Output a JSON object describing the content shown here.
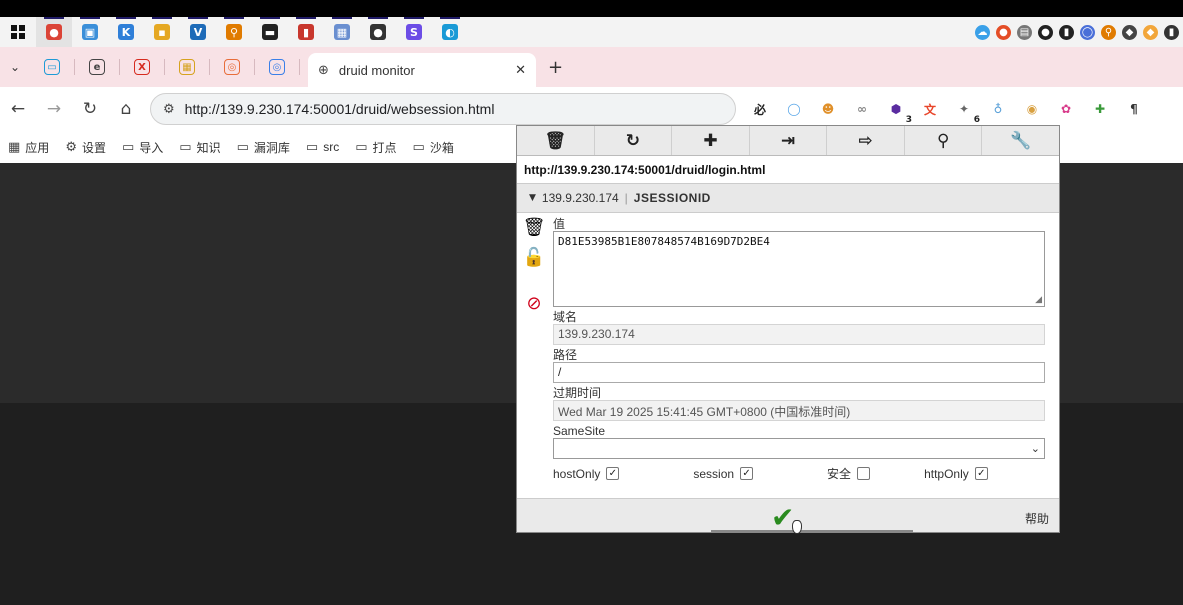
{
  "taskbar": {
    "items": [
      {
        "name": "chrome-icon",
        "glyph": "●",
        "color": "#db4437"
      },
      {
        "name": "app-icon-blue",
        "glyph": "▣",
        "color": "#3b8fd9"
      },
      {
        "name": "app-icon-k",
        "glyph": "K",
        "color": "#2f7fd8"
      },
      {
        "name": "app-icon-yellow",
        "glyph": "▪",
        "color": "#e5a823"
      },
      {
        "name": "app-icon-v",
        "glyph": "V",
        "color": "#1e6bb8"
      },
      {
        "name": "search-app-icon",
        "glyph": "⚲",
        "color": "#e07b00"
      },
      {
        "name": "terminal-icon",
        "glyph": "▬",
        "color": "#222222"
      },
      {
        "name": "app-icon-red",
        "glyph": "▮",
        "color": "#c8372d"
      },
      {
        "name": "app-icon-grid",
        "glyph": "▦",
        "color": "#6a8fd0"
      },
      {
        "name": "app-icon-dark",
        "glyph": "●",
        "color": "#333333"
      },
      {
        "name": "app-icon-s",
        "glyph": "S",
        "color": "#6c4de6"
      },
      {
        "name": "edge-icon",
        "glyph": "◐",
        "color": "#1a9ad6"
      }
    ],
    "tray": [
      {
        "name": "cloud-icon",
        "glyph": "☁",
        "color": "#3aa0e8"
      },
      {
        "name": "tray-app-icon",
        "glyph": "●",
        "color": "#e44d26"
      },
      {
        "name": "chat-icon",
        "glyph": "▤",
        "color": "#777777"
      },
      {
        "name": "tray-dark-icon",
        "glyph": "●",
        "color": "#222222"
      },
      {
        "name": "mic-icon",
        "glyph": "▮",
        "color": "#222222"
      },
      {
        "name": "tray-circle-icon",
        "glyph": "◯",
        "color": "#4a6fd8"
      },
      {
        "name": "tray-key-icon",
        "glyph": "⚲",
        "color": "#e07b00"
      },
      {
        "name": "tray-box-icon",
        "glyph": "◆",
        "color": "#444444"
      },
      {
        "name": "tray-flame-icon",
        "glyph": "◆",
        "color": "#f2a63a"
      },
      {
        "name": "tray-extra-icon",
        "glyph": "▮",
        "color": "#333333"
      }
    ]
  },
  "tabs": {
    "pinned": [
      {
        "name": "pinned-tab-bilibili",
        "glyph": "▭",
        "color": "#1e9ad6"
      },
      {
        "name": "pinned-tab-e",
        "glyph": "e",
        "color": "#444444"
      },
      {
        "name": "pinned-tab-x",
        "glyph": "X",
        "color": "#d62a1e"
      },
      {
        "name": "pinned-tab-yellow",
        "glyph": "▦",
        "color": "#d6a21e"
      },
      {
        "name": "pinned-tab-chrome",
        "glyph": "◎",
        "color": "#e86d3a"
      },
      {
        "name": "pinned-tab-circle",
        "glyph": "◎",
        "color": "#3a7fe8"
      }
    ],
    "active_title": "druid monitor",
    "close_glyph": "✕",
    "new_tab_glyph": "+"
  },
  "toolbar": {
    "url": "http://139.9.230.174:50001/druid/websession.html",
    "extensions": [
      {
        "name": "ext-bidu-icon",
        "glyph": "必",
        "color": "#222222",
        "badge": ""
      },
      {
        "name": "ext-ring-icon",
        "glyph": "◯",
        "color": "#58a6e8",
        "badge": ""
      },
      {
        "name": "ext-person-icon",
        "glyph": "☻",
        "color": "#e0902a",
        "badge": ""
      },
      {
        "name": "ext-link-icon",
        "glyph": "∞",
        "color": "#888888",
        "badge": ""
      },
      {
        "name": "ext-hex-icon",
        "glyph": "⬢",
        "color": "#5a2ca0",
        "badge": "3"
      },
      {
        "name": "ext-translate-icon",
        "glyph": "文",
        "color": "#e8452a",
        "badge": ""
      },
      {
        "name": "ext-puzzle-icon",
        "glyph": "✦",
        "color": "#666666",
        "badge": "6"
      },
      {
        "name": "ext-drop-icon",
        "glyph": "♁",
        "color": "#5aa0d8",
        "badge": ""
      },
      {
        "name": "ext-cookie-icon",
        "glyph": "◉",
        "color": "#d8a040",
        "badge": ""
      },
      {
        "name": "ext-pink-icon",
        "glyph": "✿",
        "color": "#d83a8a",
        "badge": ""
      },
      {
        "name": "ext-plus-icon",
        "glyph": "✚",
        "color": "#3a9a3a",
        "badge": ""
      },
      {
        "name": "ext-pilcrow-icon",
        "glyph": "¶",
        "color": "#333333",
        "badge": ""
      }
    ]
  },
  "bookmarks": [
    {
      "name": "bookmark-apps",
      "icon": "▦",
      "label": "应用"
    },
    {
      "name": "bookmark-settings",
      "icon": "⚙",
      "label": "设置"
    },
    {
      "name": "bookmark-import",
      "icon": "▭",
      "label": "导入"
    },
    {
      "name": "bookmark-knowledge",
      "icon": "▭",
      "label": "知识"
    },
    {
      "name": "bookmark-vuln-db",
      "icon": "▭",
      "label": "漏洞库"
    },
    {
      "name": "bookmark-src",
      "icon": "▭",
      "label": "src"
    },
    {
      "name": "bookmark-checkin",
      "icon": "▭",
      "label": "打点"
    },
    {
      "name": "bookmark-sandbox",
      "icon": "▭",
      "label": "沙箱"
    }
  ],
  "cookie_editor": {
    "tools": [
      {
        "name": "delete-all-icon",
        "glyph": "🗑"
      },
      {
        "name": "refresh-icon",
        "glyph": "↻"
      },
      {
        "name": "add-cookie-icon",
        "glyph": "✚"
      },
      {
        "name": "import-icon",
        "glyph": "⇥"
      },
      {
        "name": "export-icon",
        "glyph": "⇨"
      },
      {
        "name": "search-icon",
        "glyph": "⚲"
      },
      {
        "name": "options-icon",
        "glyph": "🔧"
      }
    ],
    "page_url": "http://139.9.230.174:50001/druid/login.html",
    "cookie_domain": "139.9.230.174",
    "cookie_name": "JSESSIONID",
    "value_label": "值",
    "value": "D81E53985B1E807848574B169D7D2BE4",
    "domain_label": "域名",
    "domain_value": "139.9.230.174",
    "path_label": "路径",
    "path_value": "/",
    "expiry_label": "过期时间",
    "expiry_value": "Wed Mar 19 2025 15:41:45 GMT+0800 (中国标准时间)",
    "samesite_label": "SameSite",
    "samesite_value": "",
    "flags": [
      {
        "name": "hostonly-checkbox",
        "label": "hostOnly",
        "checked": true
      },
      {
        "name": "session-checkbox",
        "label": "session",
        "checked": true
      },
      {
        "name": "secure-checkbox",
        "label": "安全",
        "checked": false
      },
      {
        "name": "httponly-checkbox",
        "label": "httpOnly",
        "checked": true
      }
    ],
    "help_label": "帮助",
    "colors": {
      "ok": "#2a8b1f",
      "block": "#d0021b"
    }
  }
}
